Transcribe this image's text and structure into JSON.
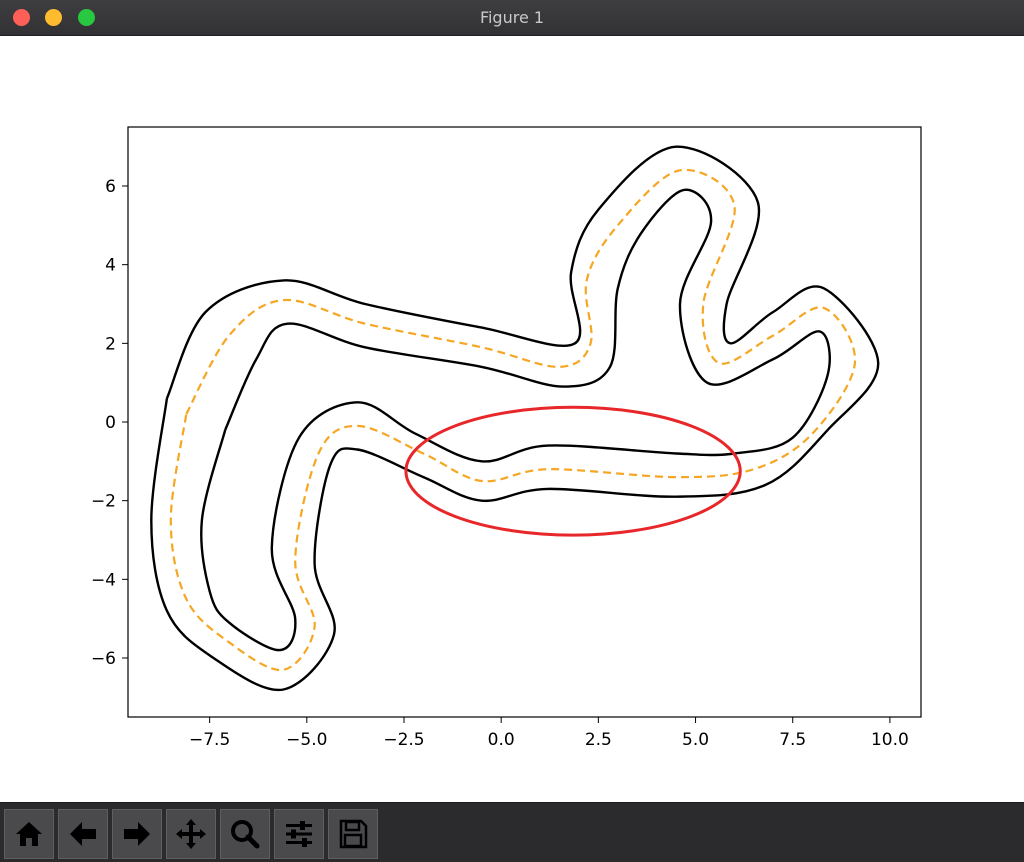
{
  "window": {
    "title": "Figure 1"
  },
  "toolbar": {
    "buttons": [
      {
        "icon": "home-icon",
        "label": "Home"
      },
      {
        "icon": "back-arrow-icon",
        "label": "Back"
      },
      {
        "icon": "forward-arrow-icon",
        "label": "Forward"
      },
      {
        "icon": "pan-icon",
        "label": "Pan"
      },
      {
        "icon": "zoom-icon",
        "label": "Zoom"
      },
      {
        "icon": "configure-subplots-icon",
        "label": "Configure subplots"
      },
      {
        "icon": "save-icon",
        "label": "Save"
      }
    ]
  },
  "chart_data": {
    "type": "line",
    "title": "",
    "xlabel": "",
    "ylabel": "",
    "xlim": [
      -9.6,
      10.8
    ],
    "ylim": [
      -7.5,
      7.5
    ],
    "xticks": [
      "−7.5",
      "−5.0",
      "−2.5",
      "0.0",
      "2.5",
      "5.0",
      "7.5",
      "10.0"
    ],
    "xtick_values": [
      -7.5,
      -5.0,
      -2.5,
      0.0,
      2.5,
      5.0,
      7.5,
      10.0
    ],
    "yticks": [
      "6",
      "4",
      "2",
      "0",
      "−2",
      "−4",
      "−6"
    ],
    "ytick_values": [
      6,
      4,
      2,
      0,
      -2,
      -4,
      -6
    ],
    "grid": false,
    "colors": {
      "boundary": "#000000",
      "centerline": "#f5a623",
      "highlight": "#e8272a"
    },
    "centerline": [
      [
        -8.1,
        0.2
      ],
      [
        -7.0,
        2.2
      ],
      [
        -5.6,
        3.1
      ],
      [
        -3.5,
        2.5
      ],
      [
        -0.5,
        1.9
      ],
      [
        1.5,
        1.4
      ],
      [
        2.3,
        2.0
      ],
      [
        2.2,
        3.6
      ],
      [
        3.0,
        5.0
      ],
      [
        4.6,
        6.4
      ],
      [
        6.0,
        5.5
      ],
      [
        5.2,
        3.0
      ],
      [
        5.6,
        1.5
      ],
      [
        7.0,
        2.2
      ],
      [
        8.3,
        2.9
      ],
      [
        9.1,
        1.5
      ],
      [
        8.0,
        -0.3
      ],
      [
        6.5,
        -1.2
      ],
      [
        4.5,
        -1.4
      ],
      [
        1.2,
        -1.2
      ],
      [
        -0.5,
        -1.5
      ],
      [
        -2.0,
        -0.8
      ],
      [
        -3.7,
        -0.1
      ],
      [
        -4.7,
        -0.8
      ],
      [
        -5.3,
        -3.5
      ],
      [
        -4.8,
        -5.2
      ],
      [
        -5.6,
        -6.3
      ],
      [
        -7.0,
        -5.6
      ],
      [
        -8.1,
        -4.5
      ],
      [
        -8.5,
        -2.5
      ],
      [
        -8.1,
        0.2
      ]
    ],
    "inner_boundary": [
      [
        -7.1,
        -0.2
      ],
      [
        -6.3,
        1.6
      ],
      [
        -5.5,
        2.5
      ],
      [
        -3.5,
        1.9
      ],
      [
        -0.5,
        1.4
      ],
      [
        1.6,
        0.9
      ],
      [
        2.8,
        1.4
      ],
      [
        3.0,
        3.4
      ],
      [
        3.6,
        4.8
      ],
      [
        4.7,
        5.9
      ],
      [
        5.4,
        5.1
      ],
      [
        4.6,
        3.0
      ],
      [
        5.3,
        1.0
      ],
      [
        7.0,
        1.6
      ],
      [
        8.2,
        2.3
      ],
      [
        8.4,
        1.2
      ],
      [
        7.5,
        -0.4
      ],
      [
        6.0,
        -0.8
      ],
      [
        4.5,
        -0.8
      ],
      [
        1.2,
        -0.6
      ],
      [
        -0.5,
        -1.0
      ],
      [
        -2.2,
        -0.3
      ],
      [
        -3.7,
        0.5
      ],
      [
        -5.2,
        -0.4
      ],
      [
        -5.9,
        -3.2
      ],
      [
        -5.3,
        -5.0
      ],
      [
        -5.7,
        -5.8
      ],
      [
        -7.0,
        -5.1
      ],
      [
        -7.5,
        -4.3
      ],
      [
        -7.7,
        -2.5
      ],
      [
        -7.1,
        -0.2
      ]
    ],
    "outer_boundary": [
      [
        -8.6,
        0.6
      ],
      [
        -7.6,
        2.8
      ],
      [
        -5.6,
        3.6
      ],
      [
        -3.5,
        3.0
      ],
      [
        -0.5,
        2.4
      ],
      [
        1.9,
        2.0
      ],
      [
        1.8,
        3.8
      ],
      [
        2.5,
        5.4
      ],
      [
        4.5,
        7.0
      ],
      [
        6.6,
        5.6
      ],
      [
        5.8,
        3.0
      ],
      [
        5.9,
        2.0
      ],
      [
        7.0,
        2.8
      ],
      [
        8.3,
        3.4
      ],
      [
        9.7,
        1.5
      ],
      [
        8.4,
        -0.2
      ],
      [
        6.8,
        -1.6
      ],
      [
        4.5,
        -1.9
      ],
      [
        1.2,
        -1.7
      ],
      [
        -0.5,
        -2.0
      ],
      [
        -2.0,
        -1.4
      ],
      [
        -3.7,
        -0.7
      ],
      [
        -4.4,
        -1.1
      ],
      [
        -4.8,
        -3.6
      ],
      [
        -4.3,
        -5.4
      ],
      [
        -5.6,
        -6.8
      ],
      [
        -7.4,
        -6.0
      ],
      [
        -8.6,
        -4.8
      ],
      [
        -9.0,
        -2.5
      ],
      [
        -8.6,
        0.6
      ]
    ],
    "ellipse": {
      "center": [
        1.85,
        -1.25
      ],
      "width": 8.6,
      "height": 3.25
    }
  }
}
